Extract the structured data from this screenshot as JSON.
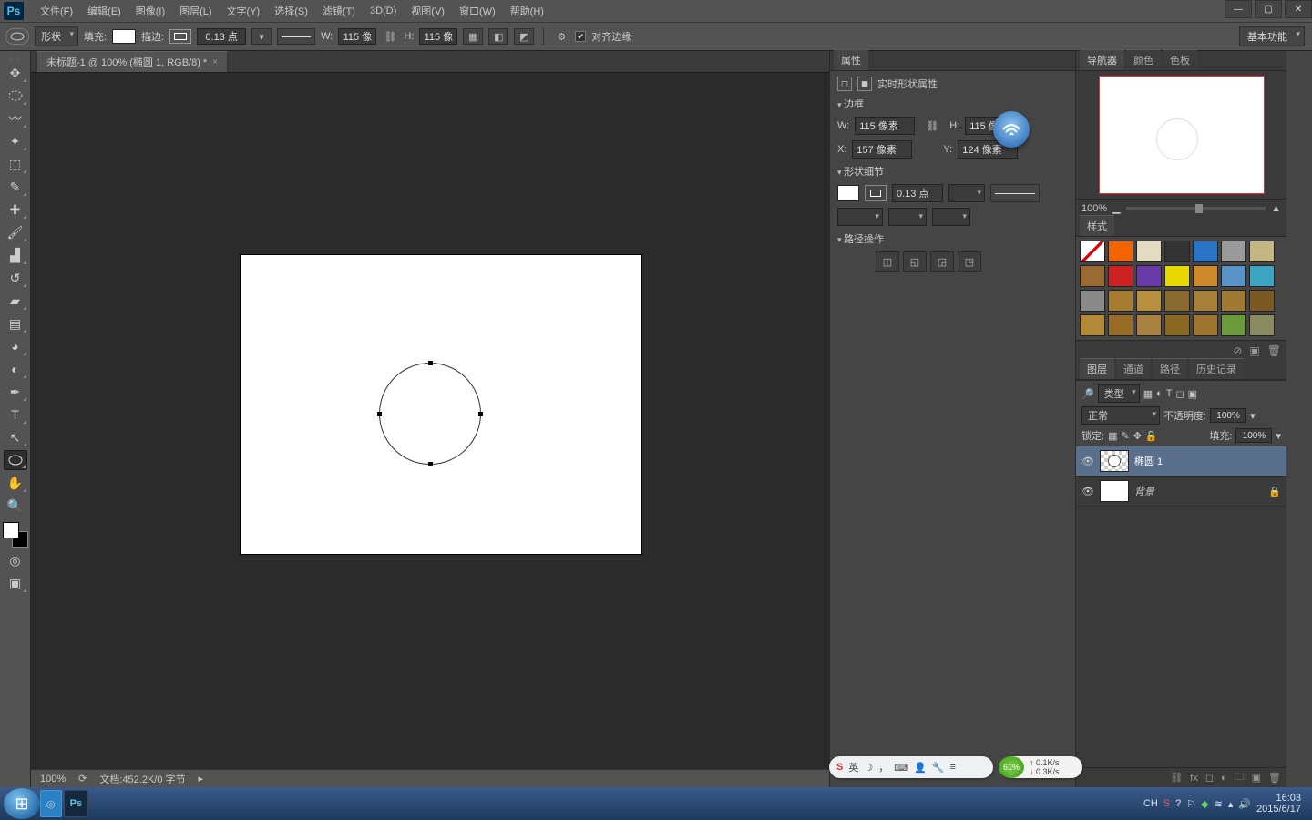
{
  "app": {
    "logo": "Ps"
  },
  "menu": [
    "文件(F)",
    "编辑(E)",
    "图像(I)",
    "图层(L)",
    "文字(Y)",
    "选择(S)",
    "滤镜(T)",
    "3D(D)",
    "视图(V)",
    "窗口(W)",
    "帮助(H)"
  ],
  "options": {
    "shape_mode": "形状",
    "fill_label": "填充:",
    "stroke_label": "描边:",
    "stroke_width": "0.13 点",
    "w_label": "W:",
    "w_value": "115 像",
    "h_label": "H:",
    "h_value": "115 像",
    "align_edges_label": "对齐边缘",
    "workspace": "基本功能"
  },
  "doc": {
    "tab_title": "未标题-1 @ 100% (椭圆 1, RGB/8) *",
    "zoom": "100%",
    "status": "文档:452.2K/0 字节"
  },
  "properties": {
    "panel_title": "属性",
    "header": "实时形状属性",
    "sections": {
      "bounds": "边框",
      "shape_detail": "形状细节",
      "path_ops": "路径操作"
    },
    "w_label": "W:",
    "w_value": "115 像素",
    "h_label": "H:",
    "h_value": "115 像素",
    "x_label": "X:",
    "x_value": "157 像素",
    "y_label": "Y:",
    "y_value": "124 像素",
    "stroke_width": "0.13 点"
  },
  "navigator": {
    "tabs": [
      "导航器",
      "颜色",
      "色板"
    ],
    "zoom": "100%"
  },
  "styles": {
    "tab": "样式"
  },
  "layers": {
    "tabs": [
      "图层",
      "通道",
      "路径",
      "历史记录"
    ],
    "kind_label": "类型",
    "blend_mode": "正常",
    "opacity_label": "不透明度:",
    "opacity_value": "100%",
    "lock_label": "锁定:",
    "fill_label": "填充:",
    "fill_value": "100%",
    "items": [
      {
        "name": "椭圆 1"
      },
      {
        "name": "背景"
      }
    ]
  },
  "taskbar": {
    "ime": "CH",
    "clock": {
      "time": "16:03",
      "date": "2015/6/17"
    }
  },
  "float": {
    "pct": "61%",
    "up": "0.1K/s",
    "down": "0.3K/s",
    "ime2": "英"
  },
  "style_colors": [
    "#fff",
    "#f26400",
    "#e5dbc2",
    "#333",
    "#2a74c8",
    "#9a9a9a",
    "#c5b783",
    "#9a6a35",
    "#c22",
    "#6a3aa8",
    "#e8d800",
    "#cc8a2c",
    "#5a93c7",
    "#3da5c1",
    "#8a8a8a",
    "#a87c2e",
    "#b78f3d",
    "#8a6a2e",
    "#a68038",
    "#a07a32",
    "#7a5a22",
    "#b28a3a",
    "#986c26",
    "#a88040",
    "#8a6620",
    "#9c7430",
    "#6a9a3a",
    "#8a8a60"
  ]
}
